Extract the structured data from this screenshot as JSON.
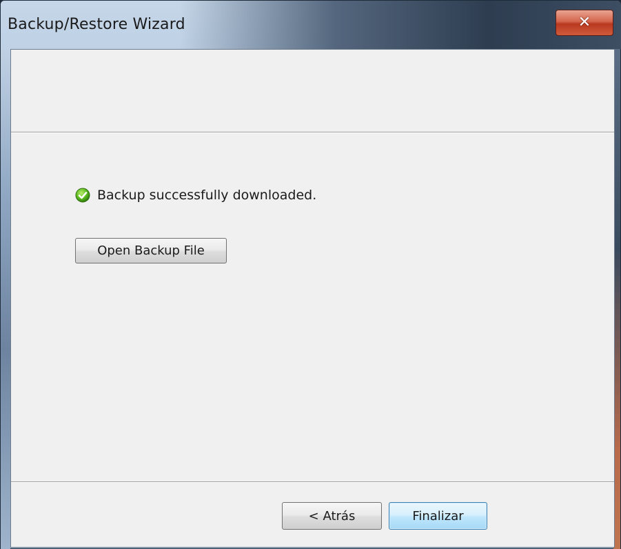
{
  "window": {
    "title": "Backup/Restore Wizard",
    "close_symbol": "✕"
  },
  "content": {
    "status_message": "Backup successfully downloaded.",
    "status_icon": "success-check-icon",
    "open_button_label": "Open Backup File"
  },
  "footer": {
    "back_label": "< Atrás",
    "finish_label": "Finalizar"
  },
  "colors": {
    "client_background": "#f0f0f0",
    "success_green": "#4caf1a",
    "close_button_red": "#c8452a",
    "default_button_blue": "#3c7fb1"
  }
}
